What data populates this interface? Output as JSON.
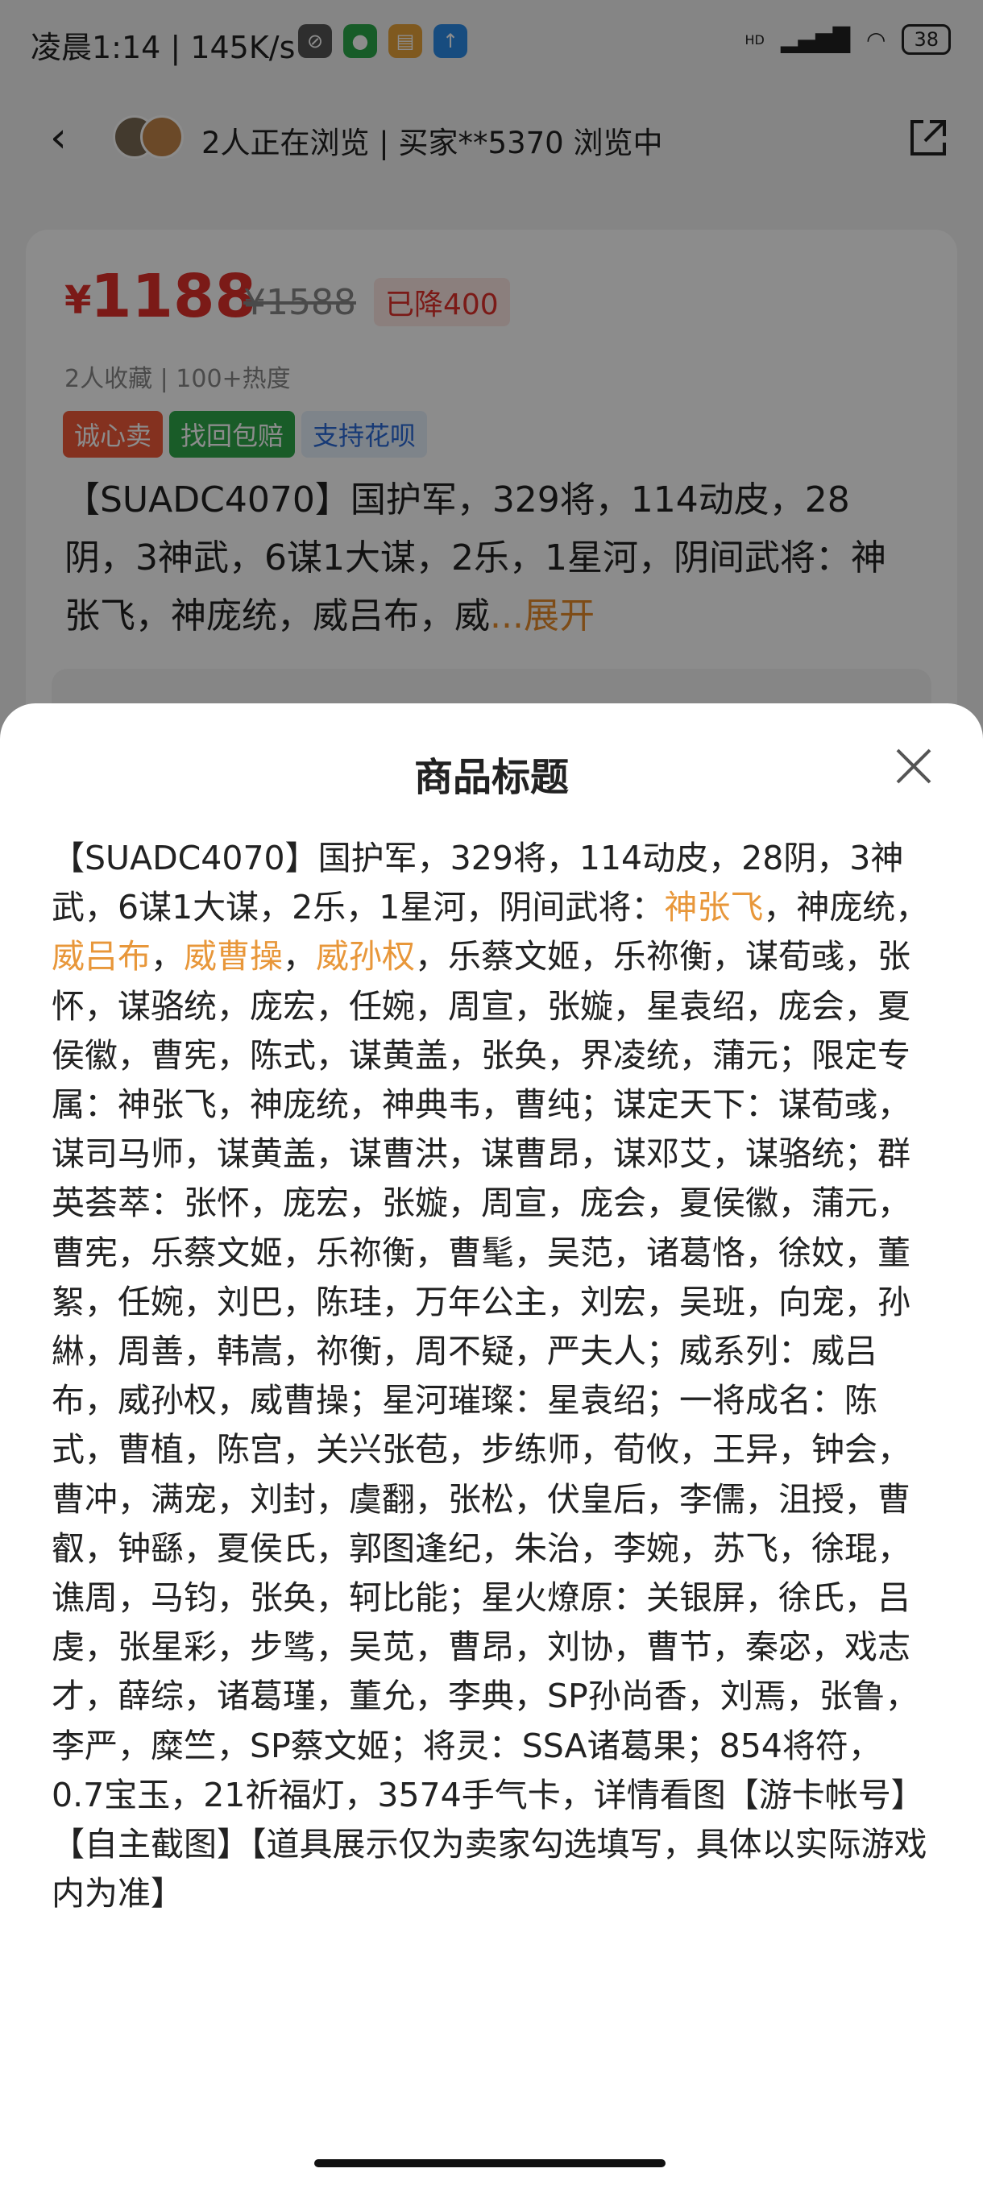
{
  "status_bar": {
    "time": "凌晨1:14",
    "speed": "145K/s",
    "network": "HD",
    "battery": "38"
  },
  "top_bar": {
    "browse_text": "2人正在浏览 | 买家**5370 浏览中"
  },
  "product_card": {
    "currency": "¥",
    "price": "1188",
    "original_price": "¥1588",
    "drop_label": "已降400",
    "meta": "2人收藏  |  100+热度",
    "tags": [
      "诚心卖",
      "找回包赔",
      "支持花呗"
    ],
    "title_preview": "【SUADC4070】国护军，329将，114动皮，28阴，3神武，6谋1大谋，2乐，1星河，阴间武将：神张飞，神庞统，威吕布，威",
    "expand_label": "...展开"
  },
  "sheet": {
    "title": "商品标题",
    "body_pre": "【SUADC4070】国护军，329将，114动皮，28阴，3神武，6谋1大谋，2乐，1星河，阴间武将：",
    "highlight_1": "神张飞",
    "sep_1": "，神庞统，",
    "highlight_2": "威吕布",
    "sep_2": "，",
    "highlight_3": "威曹操",
    "sep_3": "，",
    "highlight_4": "威孙权",
    "body_post": "，乐蔡文姬，乐祢衡，谋荀彧，张怀，谋骆统，庞宏，任婉，周宣，张嫙，星袁绍，庞会，夏侯徽，曹宪，陈式，谋黄盖，张奂，界凌统，蒲元；限定专属：神张飞，神庞统，神典韦，曹纯；谋定天下：谋荀彧，谋司马师，谋黄盖，谋曹洪，谋曹昂，谋邓艾，谋骆统；群英荟萃：张怀，庞宏，张嫙，周宣，庞会，夏侯徽，蒲元，曹宪，乐蔡文姬，乐祢衡，曹髦，吴范，诸葛恪，徐妏，董絮，任婉，刘巴，陈珪，万年公主，刘宏，吴班，向宠，孙綝，周善，韩嵩，祢衡，周不疑，严夫人；威系列：威吕布，威孙权，威曹操；星河璀璨：星袁绍；一将成名：陈式，曹植，陈宫，关兴张苞，步练师，荀攸，王异，钟会，曹冲，满宠，刘封，虞翻，张松，伏皇后，李儒，沮授，曹叡，钟繇，夏侯氏，郭图逢纪，朱治，李婉，苏飞，徐琨，谯周，马钧，张奂，轲比能；星火燎原：关银屏，徐氏，吕虔，张星彩，步骘，吴苋，曹昂，刘协，曹节，秦宓，戏志才，薛综，诸葛瑾，董允，李典，SP孙尚香，刘焉，张鲁，李严，糜竺，SP蔡文姬；将灵：SSA诸葛果；854将符，0.7宝玉，21祈福灯，3574手气卡，详情看图【游卡帐号】【自主截图】【道具展示仅为卖家勾选填写，具体以实际游戏内为准】"
  },
  "colors": {
    "price_red": "#e0302a",
    "highlight_orange": "#e8973a"
  }
}
